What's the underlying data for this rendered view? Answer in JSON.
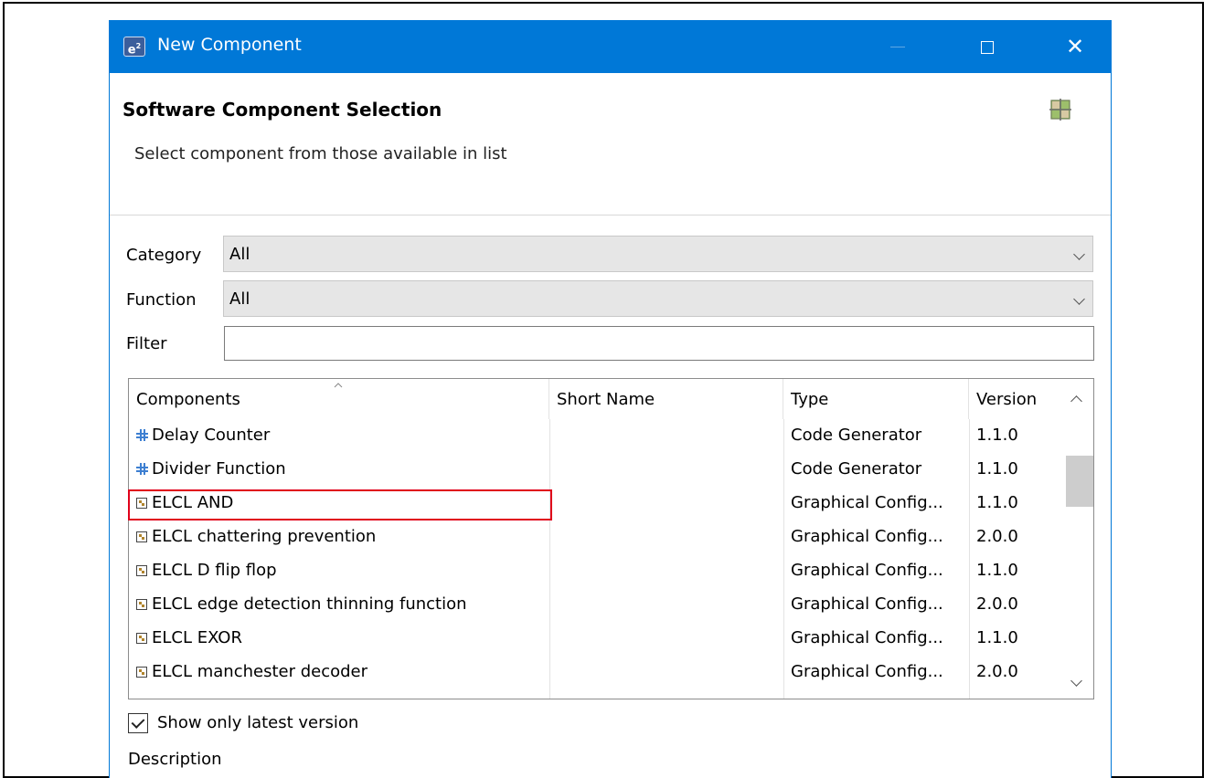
{
  "window": {
    "app_icon_text": "e²",
    "title": "New Component",
    "accent_color": "#0078d7"
  },
  "header": {
    "title": "Software Component Selection",
    "subtitle": "Select component from those available in list"
  },
  "form": {
    "category_label": "Category",
    "category_value": "All",
    "function_label": "Function",
    "function_value": "All",
    "filter_label": "Filter",
    "filter_value": ""
  },
  "table": {
    "columns": [
      "Components",
      "Short Name",
      "Type",
      "Version"
    ],
    "rows": [
      {
        "icon": "grid",
        "name": "Delay Counter",
        "short_name": "",
        "type": "Code Generator",
        "version": "1.1.0"
      },
      {
        "icon": "grid",
        "name": "Divider Function",
        "short_name": "",
        "type": "Code Generator",
        "version": "1.1.0"
      },
      {
        "icon": "graph",
        "name": "ELCL AND",
        "short_name": "",
        "type": "Graphical Config...",
        "version": "1.1.0"
      },
      {
        "icon": "graph",
        "name": "ELCL chattering prevention",
        "short_name": "",
        "type": "Graphical Config...",
        "version": "2.0.0"
      },
      {
        "icon": "graph",
        "name": "ELCL D flip flop",
        "short_name": "",
        "type": "Graphical Config...",
        "version": "1.1.0"
      },
      {
        "icon": "graph",
        "name": "ELCL edge detection thinning function",
        "short_name": "",
        "type": "Graphical Config...",
        "version": "2.0.0"
      },
      {
        "icon": "graph",
        "name": "ELCL EXOR",
        "short_name": "",
        "type": "Graphical Config...",
        "version": "1.1.0"
      },
      {
        "icon": "graph",
        "name": "ELCL manchester decoder",
        "short_name": "",
        "type": "Graphical Config...",
        "version": "2.0.0"
      }
    ],
    "highlight_color": "#e0001b"
  },
  "options": {
    "show_latest_label": "Show only latest version",
    "show_latest_checked": true
  },
  "description_label": "Description"
}
